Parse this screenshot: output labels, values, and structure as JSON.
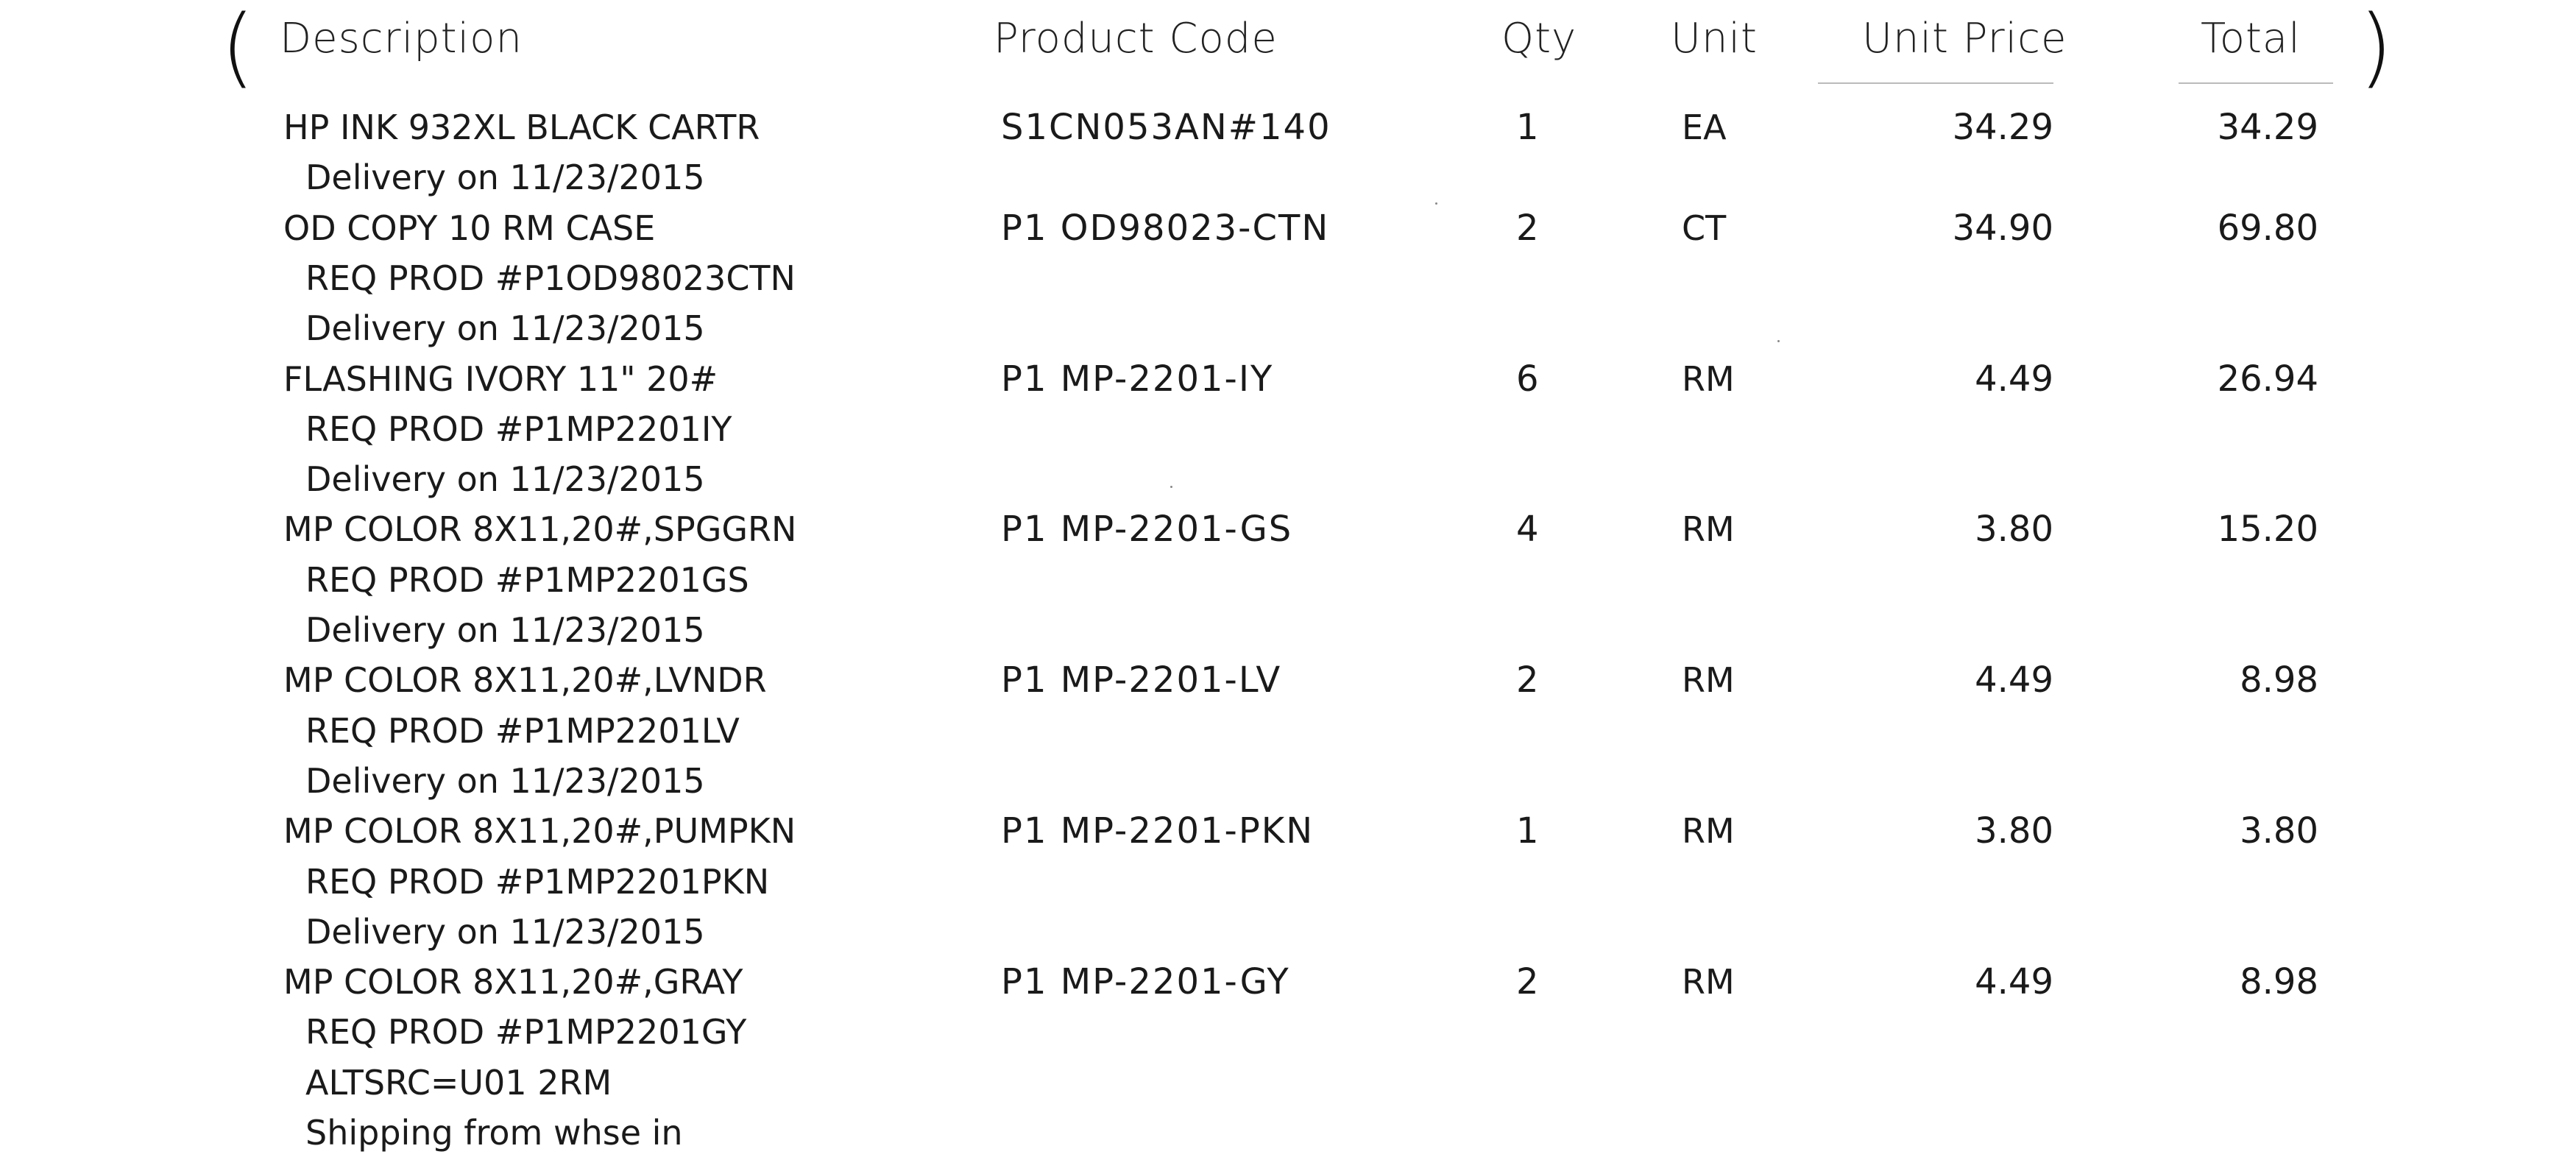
{
  "header": {
    "description": "Description",
    "product_code": "Product Code",
    "qty": "Qty",
    "unit": "Unit",
    "unit_price": "Unit Price",
    "total": "Total"
  },
  "items": [
    {
      "description": "HP INK 932XL BLACK CARTR",
      "sub": [
        "Delivery on 11/23/2015"
      ],
      "code": "S1CN053AN#140",
      "qty": "1",
      "unit": "EA",
      "unit_price": "34.29",
      "total": "34.29"
    },
    {
      "description": "OD COPY 10 RM CASE",
      "sub": [
        "REQ PROD #P1OD98023CTN",
        "Delivery on 11/23/2015"
      ],
      "code": "P1 OD98023-CTN",
      "qty": "2",
      "unit": "CT",
      "unit_price": "34.90",
      "total": "69.80"
    },
    {
      "description": "FLASHING IVORY 11\" 20#",
      "sub": [
        "REQ PROD #P1MP2201IY",
        "Delivery on 11/23/2015"
      ],
      "code": "P1 MP-2201-IY",
      "qty": "6",
      "unit": "RM",
      "unit_price": "4.49",
      "total": "26.94"
    },
    {
      "description": "MP COLOR 8X11,20#,SPGGRN",
      "sub": [
        "REQ PROD #P1MP2201GS",
        "Delivery on 11/23/2015"
      ],
      "code": "P1 MP-2201-GS",
      "qty": "4",
      "unit": "RM",
      "unit_price": "3.80",
      "total": "15.20"
    },
    {
      "description": "MP COLOR 8X11,20#,LVNDR",
      "sub": [
        "REQ PROD #P1MP2201LV",
        "Delivery on 11/23/2015"
      ],
      "code": "P1 MP-2201-LV",
      "qty": "2",
      "unit": "RM",
      "unit_price": "4.49",
      "total": "8.98"
    },
    {
      "description": "MP COLOR 8X11,20#,PUMPKN",
      "sub": [
        "REQ PROD #P1MP2201PKN",
        "Delivery on 11/23/2015"
      ],
      "code": "P1 MP-2201-PKN",
      "qty": "1",
      "unit": "RM",
      "unit_price": "3.80",
      "total": "3.80"
    },
    {
      "description": "MP COLOR 8X11,20#,GRAY",
      "sub": [
        "REQ PROD #P1MP2201GY",
        "ALTSRC=U01 2RM",
        "Shipping from whse in"
      ],
      "code": "P1 MP-2201-GY",
      "qty": "2",
      "unit": "RM",
      "unit_price": "4.49",
      "total": "8.98"
    }
  ]
}
